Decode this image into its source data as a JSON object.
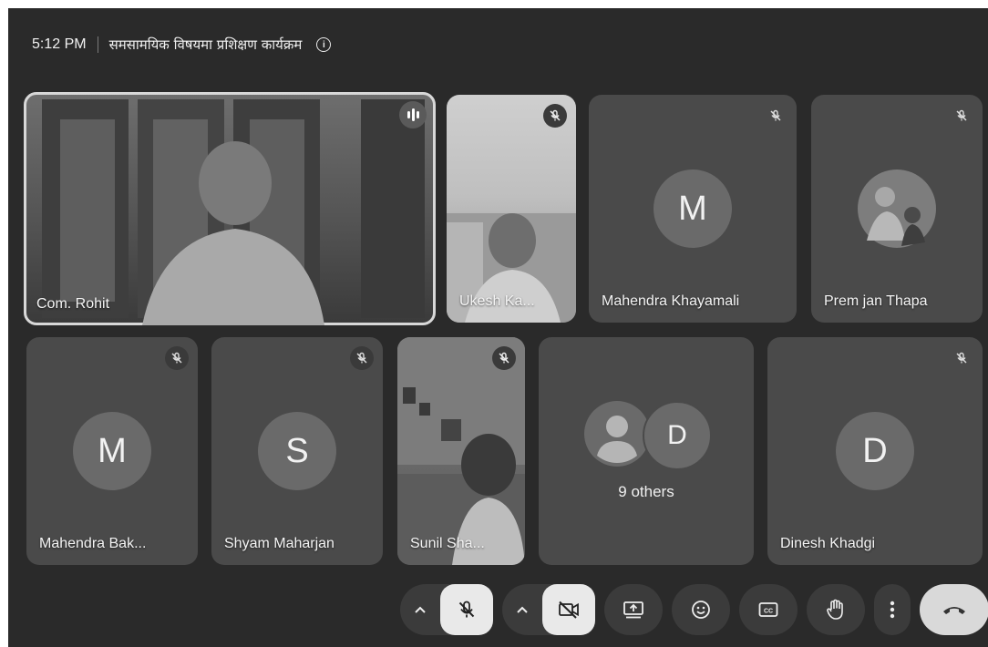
{
  "meeting": {
    "time": "5:12 PM",
    "title": "समसामयिक विषयमा प्रशिक्षण कार्यक्रम"
  },
  "participants": [
    {
      "name": "Com. Rohit",
      "type": "video",
      "speaking": true
    },
    {
      "name": "Ukesh Ka...",
      "type": "video",
      "muted": true
    },
    {
      "name": "Mahendra Khayamali",
      "type": "letter",
      "initial": "M",
      "muted": true
    },
    {
      "name": "Prem jan Thapa",
      "type": "photo",
      "muted": true
    },
    {
      "name": "Mahendra Bak...",
      "type": "letter",
      "initial": "M",
      "muted": true
    },
    {
      "name": "Shyam Maharjan",
      "type": "letter",
      "initial": "S",
      "muted": true
    },
    {
      "name": "Sunil Sha...",
      "type": "video",
      "muted": true
    },
    {
      "name": "Dinesh Khadgi",
      "type": "letter",
      "initial": "D",
      "muted": true
    }
  ],
  "others": {
    "label": "9 others",
    "initial": "D"
  },
  "controls": {
    "items": [
      "chevron-up-icon",
      "mic-off-icon",
      "chevron-up-icon",
      "camera-off-icon",
      "present-screen-icon",
      "emoji-icon",
      "captions-icon",
      "raise-hand-icon",
      "more-options-icon",
      "end-call-icon"
    ]
  },
  "colors": {
    "background": "#2a2a2a",
    "tile": "#4a4a4a",
    "control": "#3b3b3b"
  }
}
